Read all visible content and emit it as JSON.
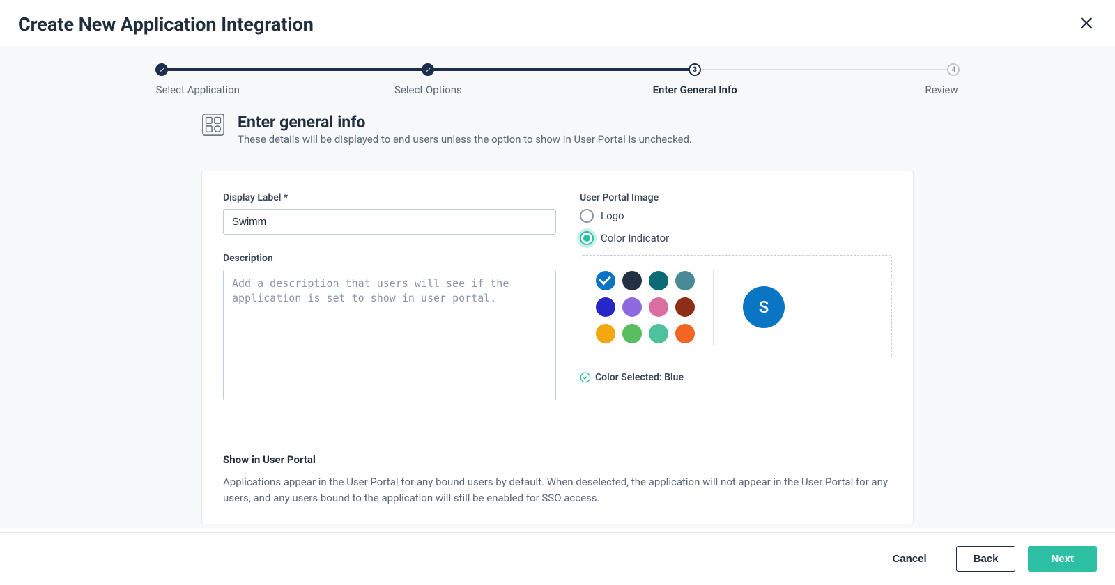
{
  "header": {
    "title": "Create New Application Integration"
  },
  "stepper": {
    "steps": [
      {
        "label": "Select Application",
        "state": "done"
      },
      {
        "label": "Select Options",
        "state": "done"
      },
      {
        "label": "Enter General Info",
        "state": "current",
        "num": "3"
      },
      {
        "label": "Review",
        "state": "pending",
        "num": "4"
      }
    ]
  },
  "section": {
    "title": "Enter general info",
    "subtitle": "These details will be displayed to end users unless the option to show in User Portal is unchecked."
  },
  "form": {
    "display_label_label": "Display Label *",
    "display_label_value": "Swimm",
    "description_label": "Description",
    "description_placeholder": "Add a description that users will see if the application is set to show in user portal.",
    "user_portal_image_label": "User Portal Image",
    "radio_logo": "Logo",
    "radio_color": "Color Indicator",
    "selected_radio": "color",
    "colors": [
      {
        "name": "blue",
        "hex": "#0a75c2",
        "selected": true
      },
      {
        "name": "navy",
        "hex": "#233044"
      },
      {
        "name": "teal",
        "hex": "#0b6b74"
      },
      {
        "name": "slate",
        "hex": "#4a8a96"
      },
      {
        "name": "indigo",
        "hex": "#2528c7"
      },
      {
        "name": "purple",
        "hex": "#8d6ae0"
      },
      {
        "name": "pink",
        "hex": "#da6fa1"
      },
      {
        "name": "maroon",
        "hex": "#8f2e16"
      },
      {
        "name": "amber",
        "hex": "#f2a80f"
      },
      {
        "name": "green",
        "hex": "#57bd5e"
      },
      {
        "name": "mint",
        "hex": "#4ec29d"
      },
      {
        "name": "orange",
        "hex": "#f26522"
      }
    ],
    "preview_letter": "S",
    "preview_bg": "#0a75c2",
    "color_selected_text": "Color Selected: Blue"
  },
  "show": {
    "heading": "Show in User Portal",
    "body": "Applications appear in the User Portal for any bound users by default. When deselected, the application will not appear in the User Portal for any users, and any users bound to the application will still be enabled for SSO access."
  },
  "footer": {
    "cancel": "Cancel",
    "back": "Back",
    "next": "Next"
  }
}
